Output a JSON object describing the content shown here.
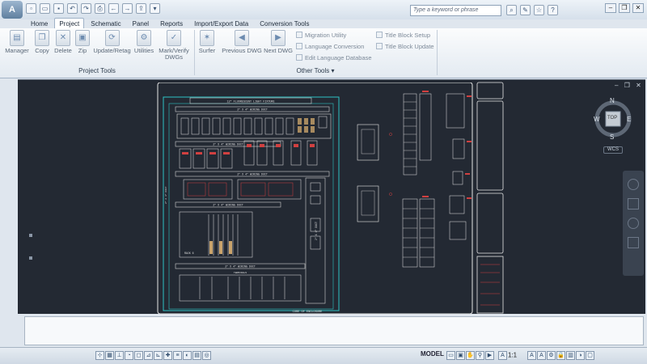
{
  "app_menu": {
    "label": "A"
  },
  "quick_access": [
    "new",
    "open",
    "save",
    "undo",
    "redo",
    "plot",
    "back",
    "forward",
    "share",
    "more"
  ],
  "tabs": [
    "Home",
    "Project",
    "Schematic",
    "Panel",
    "Reports",
    "Import/Export Data",
    "Conversion Tools"
  ],
  "active_tab": "Project",
  "search": {
    "placeholder": "Type a keyword or phrase"
  },
  "project_tools": {
    "buttons": [
      "Manager",
      "Copy",
      "Delete",
      "Zip",
      "Update/Retag",
      "Utilities",
      "Mark/Verify DWGs"
    ],
    "panel_label": "Project Tools"
  },
  "other_tools": {
    "buttons": [
      "Surfer",
      "Previous DWG",
      "Next DWG"
    ],
    "small": [
      "Migration Utility",
      "Language Conversion",
      "Edit Language Database"
    ],
    "small2": [
      "Title Block Setup",
      "Title Block Update"
    ],
    "panel_label": "Other Tools"
  },
  "viewcube": {
    "n": "N",
    "s": "S",
    "e": "E",
    "w": "W",
    "face": "TOP",
    "wcs": "WCS"
  },
  "drawing_labels": {
    "light_fixture": "12\" FLUORESCENT LIGHT FIXTURE",
    "wiring_duct_1": "2\" X 4\" WIRING DUCT",
    "wiring_duct_2": "2\" X 4\" WIRING DUCT",
    "wiring_duct_3": "2\" X 4\" WIRING DUCT",
    "wiring_duct_4": "2\" X 4\" WIRING DUCT",
    "wiring_duct_5": "2\" X 4\" WIRING DUCT",
    "terminals": "TERMINALS",
    "rack": "RACK 6",
    "duct_vertical_1": "2\" X 4\" DUCT",
    "duct_vertical_2": "2\" X 4\" DUCT",
    "enclosure": "CORE OF ENCLOSURE"
  },
  "status": {
    "model": "MODEL",
    "scale": "1:1"
  }
}
